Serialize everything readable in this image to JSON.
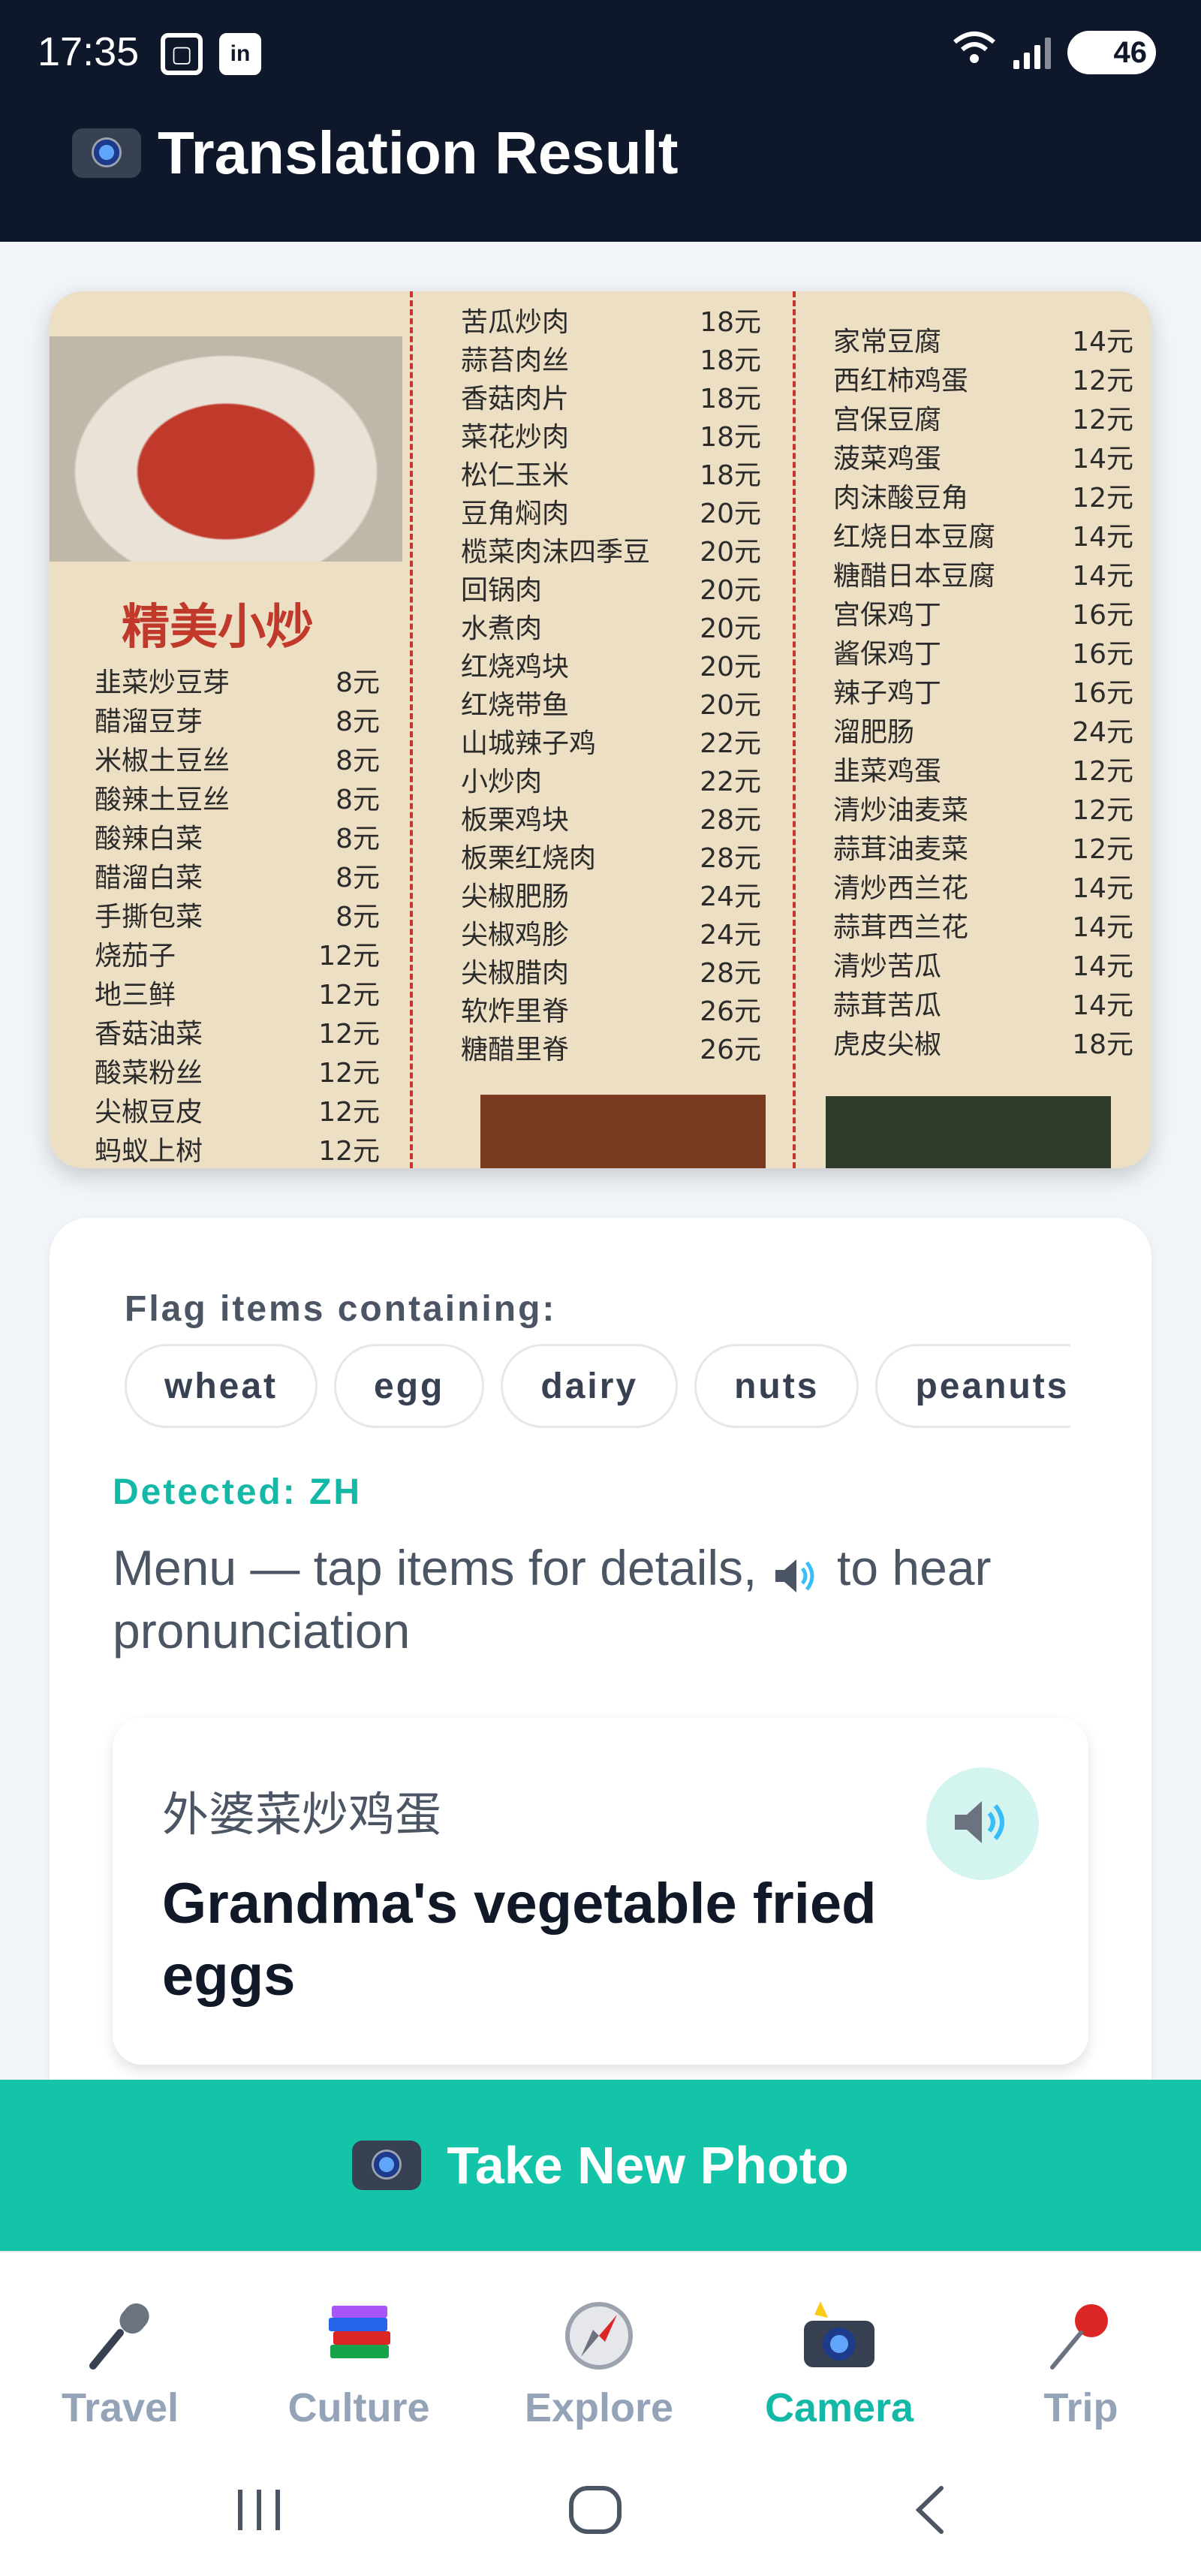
{
  "status_bar": {
    "time": "17:35",
    "left_icons": [
      "screenshot-icon",
      "linkedin-icon"
    ],
    "battery": "46"
  },
  "header": {
    "title": "Translation Result",
    "icon": "camera-icon"
  },
  "menu_photo": {
    "section_heading": "精美小炒",
    "col_a": [
      {
        "name": "韭菜炒豆芽",
        "price": "8元"
      },
      {
        "name": "醋溜豆芽",
        "price": "8元"
      },
      {
        "name": "米椒土豆丝",
        "price": "8元"
      },
      {
        "name": "酸辣土豆丝",
        "price": "8元"
      },
      {
        "name": "酸辣白菜",
        "price": "8元"
      },
      {
        "name": "醋溜白菜",
        "price": "8元"
      },
      {
        "name": "手撕包菜",
        "price": "8元"
      },
      {
        "name": "烧茄子",
        "price": "12元"
      },
      {
        "name": "地三鲜",
        "price": "12元"
      },
      {
        "name": "香菇油菜",
        "price": "12元"
      },
      {
        "name": "酸菜粉丝",
        "price": "12元"
      },
      {
        "name": "尖椒豆皮",
        "price": "12元"
      },
      {
        "name": "蚂蚁上树",
        "price": "12元"
      }
    ],
    "col_b": [
      {
        "name": "苦瓜炒肉",
        "price": "18元"
      },
      {
        "name": "蒜苔肉丝",
        "price": "18元"
      },
      {
        "name": "香菇肉片",
        "price": "18元"
      },
      {
        "name": "菜花炒肉",
        "price": "18元"
      },
      {
        "name": "松仁玉米",
        "price": "18元"
      },
      {
        "name": "豆角焖肉",
        "price": "20元"
      },
      {
        "name": "榄菜肉沫四季豆",
        "price": "20元"
      },
      {
        "name": "回锅肉",
        "price": "20元"
      },
      {
        "name": "水煮肉",
        "price": "20元"
      },
      {
        "name": "红烧鸡块",
        "price": "20元"
      },
      {
        "name": "红烧带鱼",
        "price": "20元"
      },
      {
        "name": "山城辣子鸡",
        "price": "22元"
      },
      {
        "name": "小炒肉",
        "price": "22元"
      },
      {
        "name": "板栗鸡块",
        "price": "28元"
      },
      {
        "name": "板栗红烧肉",
        "price": "28元"
      },
      {
        "name": "尖椒肥肠",
        "price": "24元"
      },
      {
        "name": "尖椒鸡胗",
        "price": "24元"
      },
      {
        "name": "尖椒腊肉",
        "price": "28元"
      },
      {
        "name": "软炸里脊",
        "price": "26元"
      },
      {
        "name": "糖醋里脊",
        "price": "26元"
      }
    ],
    "col_c": [
      {
        "name": "家常豆腐",
        "price": "14元"
      },
      {
        "name": "西红柿鸡蛋",
        "price": "12元"
      },
      {
        "name": "宫保豆腐",
        "price": "12元"
      },
      {
        "name": "菠菜鸡蛋",
        "price": "14元"
      },
      {
        "name": "肉沫酸豆角",
        "price": "12元"
      },
      {
        "name": "红烧日本豆腐",
        "price": "14元"
      },
      {
        "name": "糖醋日本豆腐",
        "price": "14元"
      },
      {
        "name": "宫保鸡丁",
        "price": "16元"
      },
      {
        "name": "酱保鸡丁",
        "price": "16元"
      },
      {
        "name": "辣子鸡丁",
        "price": "16元"
      },
      {
        "name": "溜肥肠",
        "price": "24元"
      },
      {
        "name": "韭菜鸡蛋",
        "price": "12元"
      },
      {
        "name": "清炒油麦菜",
        "price": "12元"
      },
      {
        "name": "蒜茸油麦菜",
        "price": "12元"
      },
      {
        "name": "清炒西兰花",
        "price": "14元"
      },
      {
        "name": "蒜茸西兰花",
        "price": "14元"
      },
      {
        "name": "清炒苦瓜",
        "price": "14元"
      },
      {
        "name": "蒜茸苦瓜",
        "price": "14元"
      },
      {
        "name": "虎皮尖椒",
        "price": "18元"
      }
    ]
  },
  "result_card": {
    "flag_label": "Flag items containing:",
    "allergen_chips": [
      "wheat",
      "egg",
      "dairy",
      "nuts",
      "peanuts"
    ],
    "detected_language": "Detected: ZH",
    "intro_before_icon": "Menu — tap items for details, ",
    "intro_after_icon": " to hear pronunciation",
    "item": {
      "native": "外婆菜炒鸡蛋",
      "english": "Grandma's vegetable fried eggs",
      "speak_icon": "speaker-icon"
    }
  },
  "take_photo_button": {
    "label": "Take New Photo",
    "icon": "camera-icon"
  },
  "bottom_nav": {
    "active": "Camera",
    "items": [
      {
        "label": "Travel",
        "icon": "microphone-icon"
      },
      {
        "label": "Culture",
        "icon": "books-icon"
      },
      {
        "label": "Explore",
        "icon": "compass-icon"
      },
      {
        "label": "Camera",
        "icon": "camera-flash-icon"
      },
      {
        "label": "Trip",
        "icon": "pushpin-icon"
      }
    ]
  },
  "colors": {
    "header_bg": "#0f172a",
    "accent": "#14c4a8",
    "accent_text": "#14b8a6",
    "inactive_nav": "#94a3b8"
  }
}
